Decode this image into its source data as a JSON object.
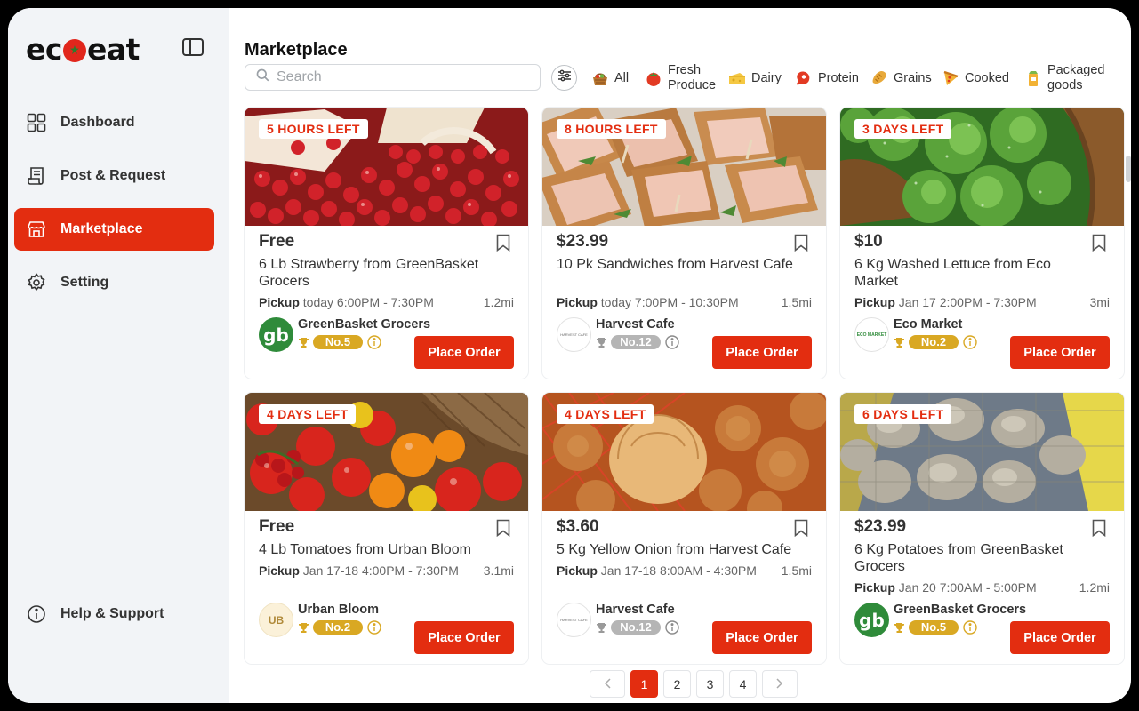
{
  "app": {
    "logo_left": "ec",
    "logo_right": "eat"
  },
  "sidebar": {
    "items": [
      {
        "label": "Dashboard",
        "icon": "grid-icon"
      },
      {
        "label": "Post & Request",
        "icon": "receipt-icon"
      },
      {
        "label": "Marketplace",
        "icon": "store-icon",
        "active": true
      },
      {
        "label": "Setting",
        "icon": "gear-icon"
      }
    ],
    "help": {
      "label": "Help & Support",
      "icon": "info-icon"
    }
  },
  "header": {
    "title": "Marketplace"
  },
  "search": {
    "placeholder": "Search"
  },
  "categories": [
    {
      "label": "All",
      "icon": "basket-icon"
    },
    {
      "label": "Fresh Produce",
      "icon": "tomato-icon"
    },
    {
      "label": "Dairy",
      "icon": "cheese-icon"
    },
    {
      "label": "Protein",
      "icon": "meat-icon"
    },
    {
      "label": "Grains",
      "icon": "bread-icon"
    },
    {
      "label": "Cooked",
      "icon": "pizza-icon"
    },
    {
      "label": "Packaged goods",
      "icon": "package-icon"
    }
  ],
  "listings": [
    {
      "time_left": "5 HOURS LEFT",
      "price": "Free",
      "title": "6 Lb Strawberry from GreenBasket Grocers",
      "pickup_label": "Pickup",
      "pickup_time": "today 6:00PM - 7:30PM",
      "distance": "1.2mi",
      "seller": "GreenBasket Grocers",
      "rank": "No.5",
      "order_label": "Place Order"
    },
    {
      "time_left": "8 HOURS LEFT",
      "price": "$23.99",
      "title": "10 Pk Sandwiches from Harvest Cafe",
      "pickup_label": "Pickup",
      "pickup_time": "today 7:00PM - 10:30PM",
      "distance": "1.5mi",
      "seller": "Harvest Cafe",
      "rank": "No.12",
      "order_label": "Place Order"
    },
    {
      "time_left": "3 DAYS LEFT",
      "price": "$10",
      "title": "6 Kg Washed Lettuce from Eco Market",
      "pickup_label": "Pickup",
      "pickup_time": "Jan 17 2:00PM - 7:30PM",
      "distance": "3mi",
      "seller": "Eco Market",
      "rank": "No.2",
      "order_label": "Place Order"
    },
    {
      "time_left": "4 DAYS LEFT",
      "price": "Free",
      "title": "4 Lb Tomatoes from Urban Bloom",
      "pickup_label": "Pickup",
      "pickup_time": "Jan 17-18 4:00PM - 7:30PM",
      "distance": "3.1mi",
      "seller": "Urban Bloom",
      "rank": "No.2",
      "order_label": "Place Order"
    },
    {
      "time_left": "4 DAYS LEFT",
      "price": "$3.60",
      "title": "5 Kg Yellow Onion from Harvest Cafe",
      "pickup_label": "Pickup",
      "pickup_time": "Jan 17-18 8:00AM - 4:30PM",
      "distance": "1.5mi",
      "seller": "Harvest Cafe",
      "rank": "No.12",
      "order_label": "Place Order"
    },
    {
      "time_left": "6 DAYS LEFT",
      "price": "$23.99",
      "title": "6 Kg Potatoes from GreenBasket Grocers",
      "pickup_label": "Pickup",
      "pickup_time": "Jan 20 7:00AM - 5:00PM",
      "distance": "1.2mi",
      "seller": "GreenBasket Grocers",
      "rank": "No.5",
      "order_label": "Place Order"
    }
  ],
  "logos": {
    "greenbasket": "gb",
    "harvest": "HARVEST CAFE",
    "eco": "ECO MARKET",
    "urban": "UB"
  },
  "pagination": {
    "pages": [
      "1",
      "2",
      "3",
      "4"
    ],
    "current": "1"
  },
  "colors": {
    "accent": "#e32d10",
    "gold": "#d9a823",
    "silver": "#b5b5b5",
    "green": "#2f8b3a"
  }
}
